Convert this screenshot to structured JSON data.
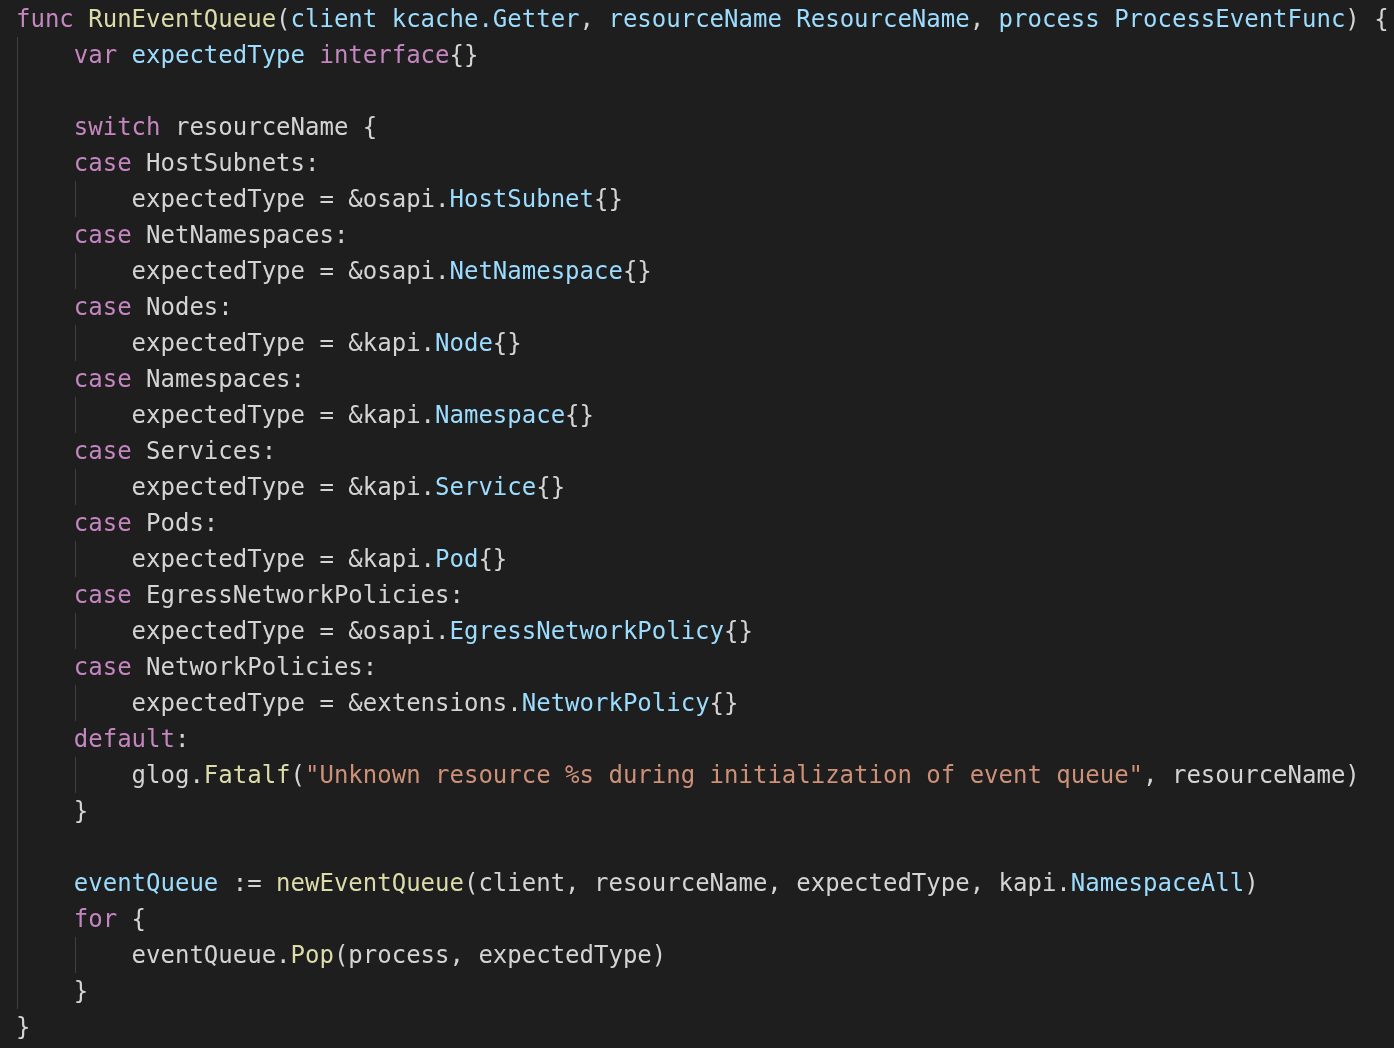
{
  "editor": {
    "lines": [
      {
        "kind": "code",
        "tokens": [
          {
            "kind": "keyword",
            "text": "func"
          },
          {
            "kind": "function",
            "text": " RunEventQueue"
          },
          {
            "kind": "plain",
            "text": "("
          },
          {
            "kind": "variable",
            "text": "client kcache.Getter"
          },
          {
            "kind": "plain",
            "text": ", "
          },
          {
            "kind": "variable",
            "text": "resourceName ResourceName"
          },
          {
            "kind": "plain",
            "text": ", "
          },
          {
            "kind": "variable",
            "text": "process ProcessEventFunc"
          },
          {
            "kind": "plain",
            "text": ") {"
          }
        ],
        "children": [
          {
            "kind": "code",
            "tokens": [
              {
                "kind": "keyword",
                "text": "var"
              },
              {
                "kind": "variable",
                "text": " expectedType"
              },
              {
                "kind": "keyword",
                "text": " interface"
              },
              {
                "kind": "plain",
                "text": "{}"
              }
            ]
          },
          {
            "kind": "blank"
          },
          {
            "kind": "code",
            "tokens": [
              {
                "kind": "keyword",
                "text": "switch"
              },
              {
                "kind": "plain",
                "text": " resourceName {"
              }
            ]
          },
          {
            "kind": "code",
            "tokens": [
              {
                "kind": "keyword",
                "text": "case"
              },
              {
                "kind": "plain",
                "text": " HostSubnets:"
              }
            ],
            "children": [
              {
                "kind": "code",
                "tokens": [
                  {
                    "kind": "plain",
                    "text": "expectedType = &osapi."
                  },
                  {
                    "kind": "variable",
                    "text": "HostSubnet"
                  },
                  {
                    "kind": "plain",
                    "text": "{}"
                  }
                ]
              }
            ]
          },
          {
            "kind": "code",
            "tokens": [
              {
                "kind": "keyword",
                "text": "case"
              },
              {
                "kind": "plain",
                "text": " NetNamespaces:"
              }
            ],
            "children": [
              {
                "kind": "code",
                "tokens": [
                  {
                    "kind": "plain",
                    "text": "expectedType = &osapi."
                  },
                  {
                    "kind": "variable",
                    "text": "NetNamespace"
                  },
                  {
                    "kind": "plain",
                    "text": "{}"
                  }
                ]
              }
            ]
          },
          {
            "kind": "code",
            "tokens": [
              {
                "kind": "keyword",
                "text": "case"
              },
              {
                "kind": "plain",
                "text": " Nodes:"
              }
            ],
            "children": [
              {
                "kind": "code",
                "tokens": [
                  {
                    "kind": "plain",
                    "text": "expectedType = &kapi."
                  },
                  {
                    "kind": "variable",
                    "text": "Node"
                  },
                  {
                    "kind": "plain",
                    "text": "{}"
                  }
                ]
              }
            ]
          },
          {
            "kind": "code",
            "tokens": [
              {
                "kind": "keyword",
                "text": "case"
              },
              {
                "kind": "plain",
                "text": " Namespaces:"
              }
            ],
            "children": [
              {
                "kind": "code",
                "tokens": [
                  {
                    "kind": "plain",
                    "text": "expectedType = &kapi."
                  },
                  {
                    "kind": "variable",
                    "text": "Namespace"
                  },
                  {
                    "kind": "plain",
                    "text": "{}"
                  }
                ]
              }
            ]
          },
          {
            "kind": "code",
            "tokens": [
              {
                "kind": "keyword",
                "text": "case"
              },
              {
                "kind": "plain",
                "text": " Services:"
              }
            ],
            "children": [
              {
                "kind": "code",
                "tokens": [
                  {
                    "kind": "plain",
                    "text": "expectedType = &kapi."
                  },
                  {
                    "kind": "variable",
                    "text": "Service"
                  },
                  {
                    "kind": "plain",
                    "text": "{}"
                  }
                ]
              }
            ]
          },
          {
            "kind": "code",
            "tokens": [
              {
                "kind": "keyword",
                "text": "case"
              },
              {
                "kind": "plain",
                "text": " Pods:"
              }
            ],
            "children": [
              {
                "kind": "code",
                "tokens": [
                  {
                    "kind": "plain",
                    "text": "expectedType = &kapi."
                  },
                  {
                    "kind": "variable",
                    "text": "Pod"
                  },
                  {
                    "kind": "plain",
                    "text": "{}"
                  }
                ]
              }
            ]
          },
          {
            "kind": "code",
            "tokens": [
              {
                "kind": "keyword",
                "text": "case"
              },
              {
                "kind": "plain",
                "text": " EgressNetworkPolicies:"
              }
            ],
            "children": [
              {
                "kind": "code",
                "tokens": [
                  {
                    "kind": "plain",
                    "text": "expectedType = &osapi."
                  },
                  {
                    "kind": "variable",
                    "text": "EgressNetworkPolicy"
                  },
                  {
                    "kind": "plain",
                    "text": "{}"
                  }
                ]
              }
            ]
          },
          {
            "kind": "code",
            "tokens": [
              {
                "kind": "keyword",
                "text": "case"
              },
              {
                "kind": "plain",
                "text": " NetworkPolicies:"
              }
            ],
            "children": [
              {
                "kind": "code",
                "tokens": [
                  {
                    "kind": "plain",
                    "text": "expectedType = &extensions."
                  },
                  {
                    "kind": "variable",
                    "text": "NetworkPolicy"
                  },
                  {
                    "kind": "plain",
                    "text": "{}"
                  }
                ]
              }
            ]
          },
          {
            "kind": "code",
            "tokens": [
              {
                "kind": "keyword",
                "text": "default"
              },
              {
                "kind": "plain",
                "text": ":"
              }
            ],
            "children": [
              {
                "kind": "code",
                "tokens": [
                  {
                    "kind": "plain",
                    "text": "glog."
                  },
                  {
                    "kind": "function",
                    "text": "Fatalf"
                  },
                  {
                    "kind": "plain",
                    "text": "("
                  },
                  {
                    "kind": "string",
                    "text": "\"Unknown resource %s during initialization of event queue\""
                  },
                  {
                    "kind": "plain",
                    "text": ", resourceName)"
                  }
                ]
              }
            ]
          },
          {
            "kind": "code",
            "tokens": [
              {
                "kind": "plain",
                "text": "}"
              }
            ]
          },
          {
            "kind": "blank"
          },
          {
            "kind": "code",
            "tokens": [
              {
                "kind": "variable",
                "text": "eventQueue"
              },
              {
                "kind": "plain",
                "text": " := "
              },
              {
                "kind": "function",
                "text": "newEventQueue"
              },
              {
                "kind": "plain",
                "text": "(client, resourceName, expectedType, kapi."
              },
              {
                "kind": "variable",
                "text": "NamespaceAll"
              },
              {
                "kind": "plain",
                "text": ")"
              }
            ]
          },
          {
            "kind": "code",
            "tokens": [
              {
                "kind": "keyword",
                "text": "for"
              },
              {
                "kind": "plain",
                "text": " {"
              }
            ],
            "children": [
              {
                "kind": "code",
                "tokens": [
                  {
                    "kind": "plain",
                    "text": "eventQueue."
                  },
                  {
                    "kind": "function",
                    "text": "Pop"
                  },
                  {
                    "kind": "plain",
                    "text": "(process, expectedType)"
                  }
                ]
              }
            ]
          },
          {
            "kind": "code",
            "tokens": [
              {
                "kind": "plain",
                "text": "}"
              }
            ]
          }
        ]
      },
      {
        "kind": "code",
        "tokens": [
          {
            "kind": "plain",
            "text": "}"
          }
        ]
      }
    ]
  }
}
